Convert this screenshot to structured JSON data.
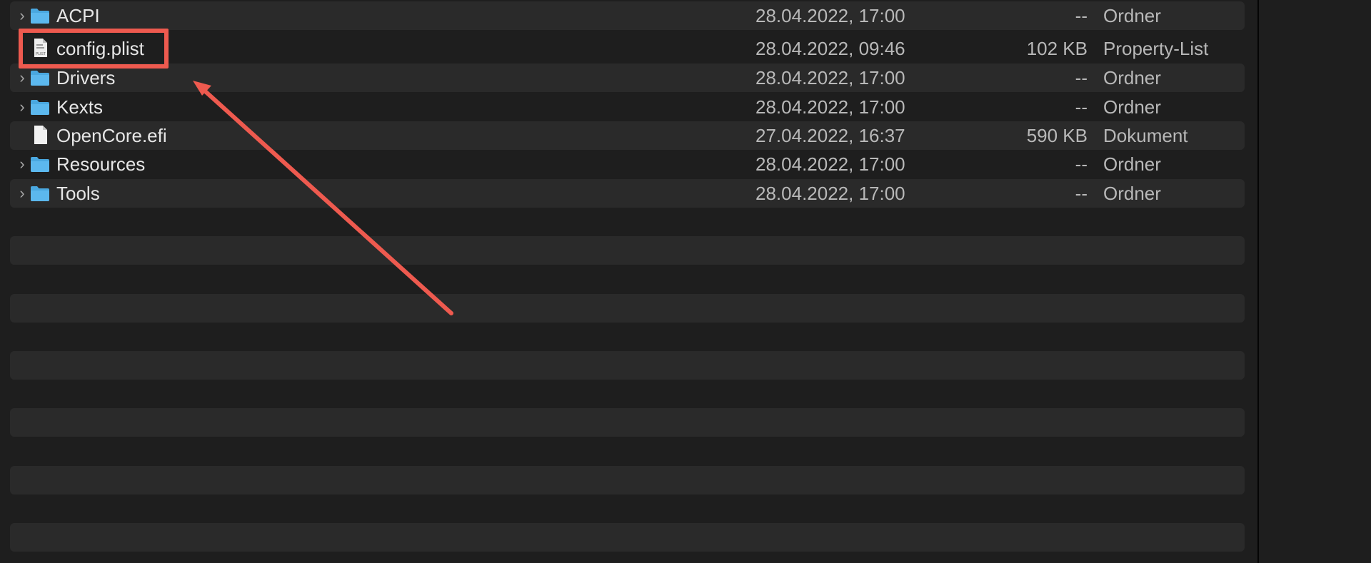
{
  "files": [
    {
      "name": "ACPI",
      "date": "28.04.2022, 17:00",
      "size": "--",
      "kind": "Ordner",
      "type": "folder"
    },
    {
      "name": "config.plist",
      "date": "28.04.2022, 09:46",
      "size": "102 KB",
      "kind": "Property-List",
      "type": "plist"
    },
    {
      "name": "Drivers",
      "date": "28.04.2022, 17:00",
      "size": "--",
      "kind": "Ordner",
      "type": "folder"
    },
    {
      "name": "Kexts",
      "date": "28.04.2022, 17:00",
      "size": "--",
      "kind": "Ordner",
      "type": "folder"
    },
    {
      "name": "OpenCore.efi",
      "date": "27.04.2022, 16:37",
      "size": "590 KB",
      "kind": "Dokument",
      "type": "document"
    },
    {
      "name": "Resources",
      "date": "28.04.2022, 17:00",
      "size": "--",
      "kind": "Ordner",
      "type": "folder"
    },
    {
      "name": "Tools",
      "date": "28.04.2022, 17:00",
      "size": "--",
      "kind": "Ordner",
      "type": "folder"
    }
  ],
  "icons": {
    "folder": "folder-icon",
    "plist": "plist-file-icon",
    "document": "document-file-icon",
    "disclosure": "chevron-right-icon"
  },
  "plist_icon_text": "PLIST",
  "annotation": {
    "highlight_color": "#ee5a4f",
    "highlight_target": "config.plist",
    "arrow_color": "#ee5a4f"
  },
  "colors": {
    "background": "#1e1e1e",
    "stripe": "#2a2a2a",
    "folder": "#4aa8e0",
    "text_primary": "#e6e6e6",
    "text_secondary": "#b8b8b8"
  }
}
